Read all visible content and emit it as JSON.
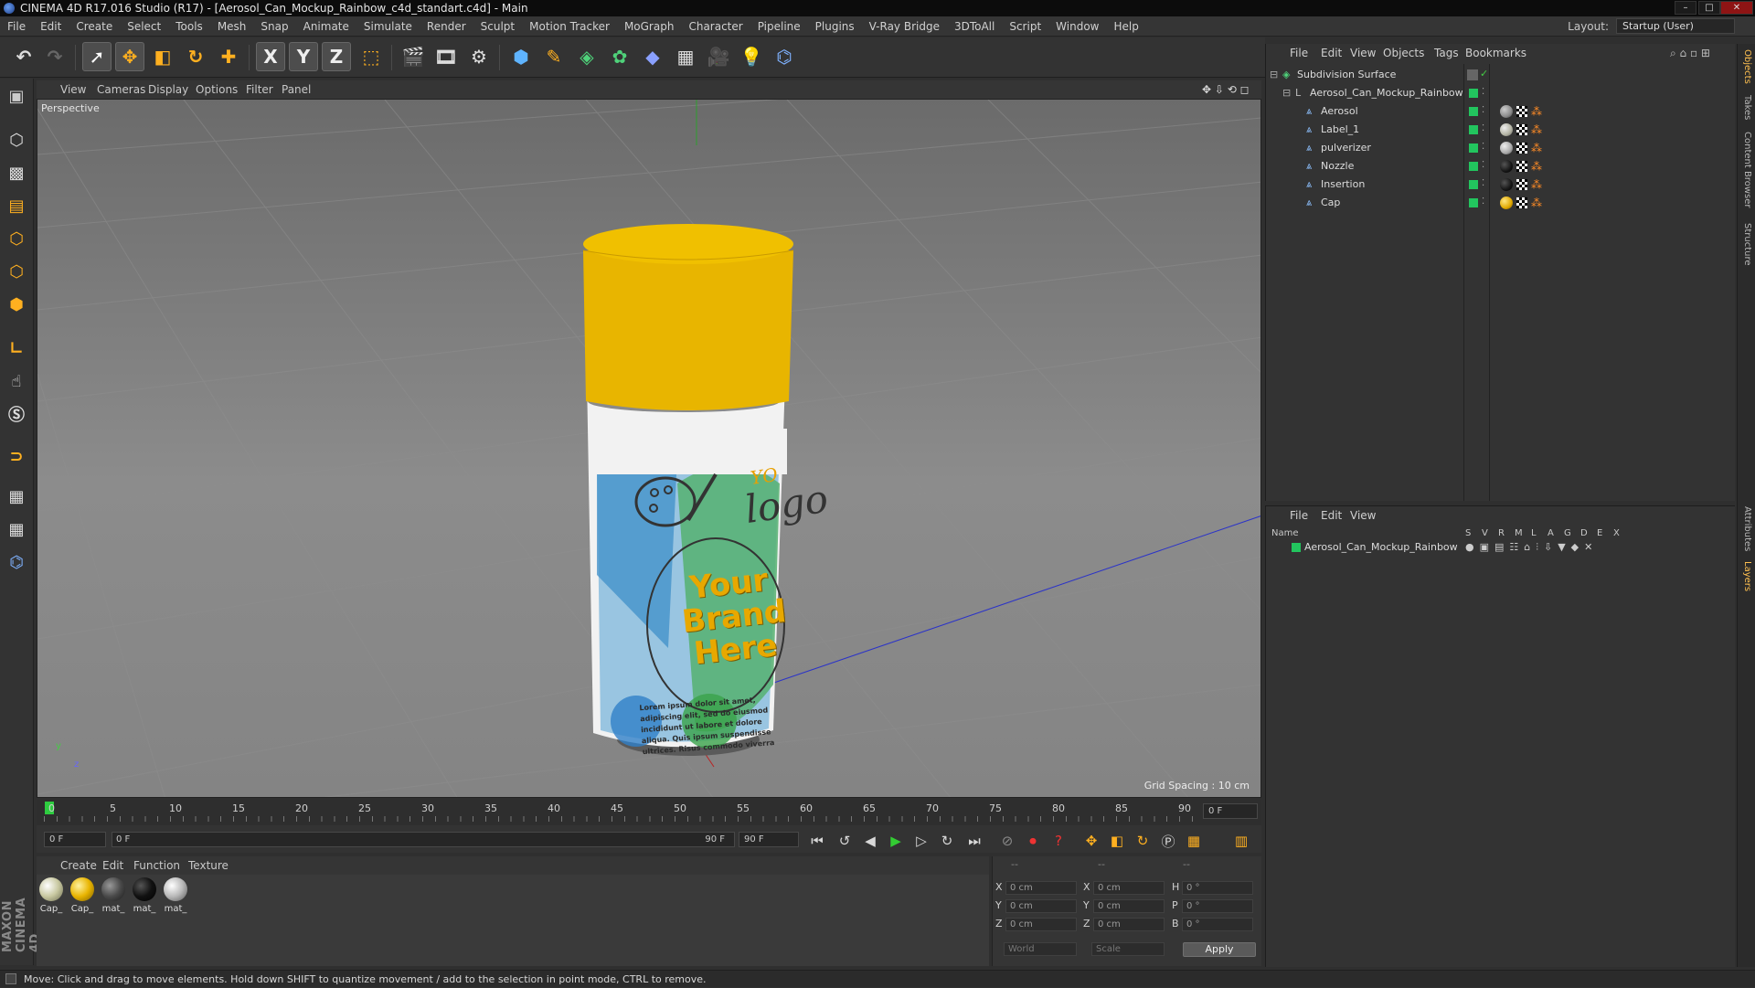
{
  "window": {
    "title": "CINEMA 4D R17.016 Studio (R17) - [Aerosol_Can_Mockup_Rainbow_c4d_standart.c4d] - Main",
    "controls": [
      "–",
      "□",
      "✕"
    ]
  },
  "menubar": {
    "items": [
      "File",
      "Edit",
      "Create",
      "Select",
      "Tools",
      "Mesh",
      "Snap",
      "Animate",
      "Simulate",
      "Render",
      "Sculpt",
      "Motion Tracker",
      "MoGraph",
      "Character",
      "Pipeline",
      "Plugins",
      "V-Ray Bridge",
      "3DToAll",
      "Script",
      "Window",
      "Help"
    ],
    "layout_label": "Layout:",
    "layout_value": "Startup (User)"
  },
  "toolbar": {
    "axis_x": "X",
    "axis_y": "Y",
    "axis_z": "Z"
  },
  "viewport": {
    "menu": [
      "View",
      "Cameras",
      "Display",
      "Options",
      "Filter",
      "Panel"
    ],
    "label": "Perspective",
    "grid_spacing": "Grid Spacing : 10 cm"
  },
  "can": {
    "logo_text": "logo",
    "logo_partial": "YO",
    "brand_line1": "Your",
    "brand_line2": "Brand",
    "brand_line3": "Here",
    "lorem": "Lorem ipsum dolor sit amet, adipiscing elit, sed do eiusmod incididunt ut labore et dolore aliqua. Quis ipsum suspendisse ultrices. Risus commodo viverra"
  },
  "timeline": {
    "ticks": [
      "0",
      "5",
      "10",
      "15",
      "20",
      "25",
      "30",
      "35",
      "40",
      "45",
      "50",
      "55",
      "60",
      "65",
      "70",
      "75",
      "80",
      "85",
      "90"
    ],
    "current_frame": "0 F",
    "start_field": "0 F",
    "range_start": "0 F",
    "range_end": "90 F",
    "end_field": "90 F"
  },
  "materials": {
    "menu": [
      "Create",
      "Edit",
      "Function",
      "Texture"
    ],
    "items": [
      {
        "name": "Cap_",
        "color": "#c8c8a0"
      },
      {
        "name": "Cap_",
        "color": "#e8b400"
      },
      {
        "name": "mat_",
        "color": "#4a4a4a"
      },
      {
        "name": "mat_",
        "color": "#111111"
      },
      {
        "name": "mat_",
        "color": "#b8b8b8"
      }
    ]
  },
  "coordinates": {
    "header": [
      "--",
      "--",
      "--"
    ],
    "rows": [
      {
        "a": "X",
        "av": "0 cm",
        "b": "X",
        "bv": "0 cm",
        "c": "H",
        "cv": "0 °"
      },
      {
        "a": "Y",
        "av": "0 cm",
        "b": "Y",
        "bv": "0 cm",
        "c": "P",
        "cv": "0 °"
      },
      {
        "a": "Z",
        "av": "0 cm",
        "b": "Z",
        "bv": "0 cm",
        "c": "B",
        "cv": "0 °"
      }
    ],
    "mode": "World",
    "transform": "Scale",
    "apply": "Apply"
  },
  "objects": {
    "menu": [
      "File",
      "Edit",
      "View",
      "Objects",
      "Tags",
      "Bookmarks"
    ],
    "tree": [
      {
        "name": "Subdivision Surface",
        "level": 0,
        "tag_color": ""
      },
      {
        "name": "Aerosol_Can_Mockup_Rainbow",
        "level": 1,
        "tag_color": ""
      },
      {
        "name": "Aerosol",
        "level": 2,
        "tag_color": "#8a8a8a"
      },
      {
        "name": "Label_1",
        "level": 2,
        "tag_color": "#b0b0a0"
      },
      {
        "name": "pulverizer",
        "level": 2,
        "tag_color": "#a8a8a8"
      },
      {
        "name": "Nozzle",
        "level": 2,
        "tag_color": "#151515"
      },
      {
        "name": "Insertion",
        "level": 2,
        "tag_color": "#151515"
      },
      {
        "name": "Cap",
        "level": 2,
        "tag_color": "#e0a800"
      }
    ]
  },
  "layers": {
    "menu": [
      "File",
      "Edit",
      "View"
    ],
    "columns": [
      "Name",
      "S",
      "V",
      "R",
      "M",
      "L",
      "A",
      "G",
      "D",
      "E",
      "X"
    ],
    "rows": [
      {
        "name": "Aerosol_Can_Mockup_Rainbow",
        "color": "#22c55e"
      }
    ]
  },
  "right_tabs": [
    "Objects",
    "Takes",
    "Content Browser",
    "Structure",
    "Attributes",
    "Layers"
  ],
  "maxon_logo": "MAXON CINEMA 4D",
  "status": "Move: Click and drag to move elements. Hold down SHIFT to quantize movement / add to the selection in point mode, CTRL to remove."
}
